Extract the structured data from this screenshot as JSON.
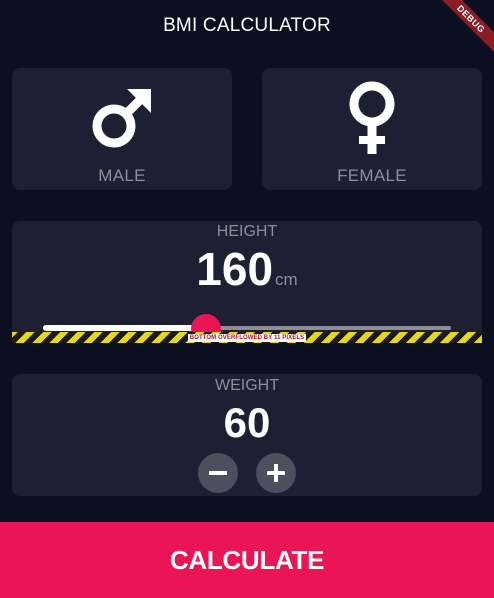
{
  "app": {
    "title": "BMI CALCULATOR",
    "debug_banner": "DEBUG"
  },
  "gender": {
    "male": {
      "label": "MALE",
      "icon": "male-symbol-icon"
    },
    "female": {
      "label": "FEMALE",
      "icon": "female-symbol-icon"
    }
  },
  "height": {
    "label": "HEIGHT",
    "value": "160",
    "unit": "cm",
    "slider_fraction": 0.4,
    "overflow_message": "BOTTOM OVERFLOWED BY 11 PIXELS"
  },
  "weight": {
    "label": "WEIGHT",
    "value": "60",
    "decrement_icon": "minus-icon",
    "increment_icon": "plus-icon"
  },
  "calculate": {
    "label": "CALCULATE"
  },
  "colors": {
    "background": "#0b0f1f",
    "card": "#1e1f33",
    "accent": "#eb1555",
    "muted_text": "#8d8e98",
    "round_button": "#4c4f5e"
  }
}
